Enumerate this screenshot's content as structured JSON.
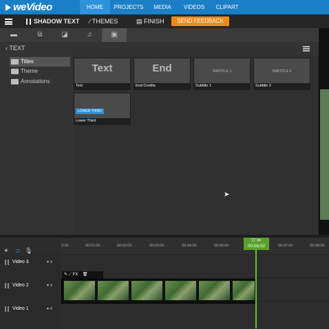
{
  "brand": {
    "logo": "weVideo"
  },
  "nav": {
    "tabs": [
      "HOME",
      "PROJECTS",
      "MEDIA",
      "VIDEOS",
      "CLIPART"
    ],
    "active": "HOME"
  },
  "toolbar": {
    "project_title": "SHADOW TEXT",
    "themes": "THEMES",
    "finish": "FINISH",
    "feedback": "SEND FEEDBACK"
  },
  "panel": {
    "back_label": "TEXT",
    "categories": [
      "Titles",
      "Theme",
      "Annotations"
    ],
    "tiles": [
      {
        "preview": "Text",
        "caption": "Text"
      },
      {
        "preview": "End",
        "caption": "End Credits"
      },
      {
        "preview": "SUBTITLE 1",
        "caption": "Subtitle 1"
      },
      {
        "preview": "SUBTITLE 2",
        "caption": "Subtitle 2"
      },
      {
        "preview": "LOWER THIRD",
        "caption": "Lower Third"
      }
    ]
  },
  "timeline": {
    "ticks": [
      "0:00",
      "00:01:00",
      "00:02:00",
      "00:03:00",
      "00:04:00",
      "00:05:00",
      "00:07:00",
      "00:08:00"
    ],
    "playhead_time": "00:06:02",
    "tracks": [
      "Video 3",
      "Video 2",
      "Video 1"
    ],
    "clip_tools": "FX"
  },
  "colors": {
    "nav": "#1b7fc6",
    "feedback": "#f08a1c",
    "playhead": "#6cba3a"
  }
}
